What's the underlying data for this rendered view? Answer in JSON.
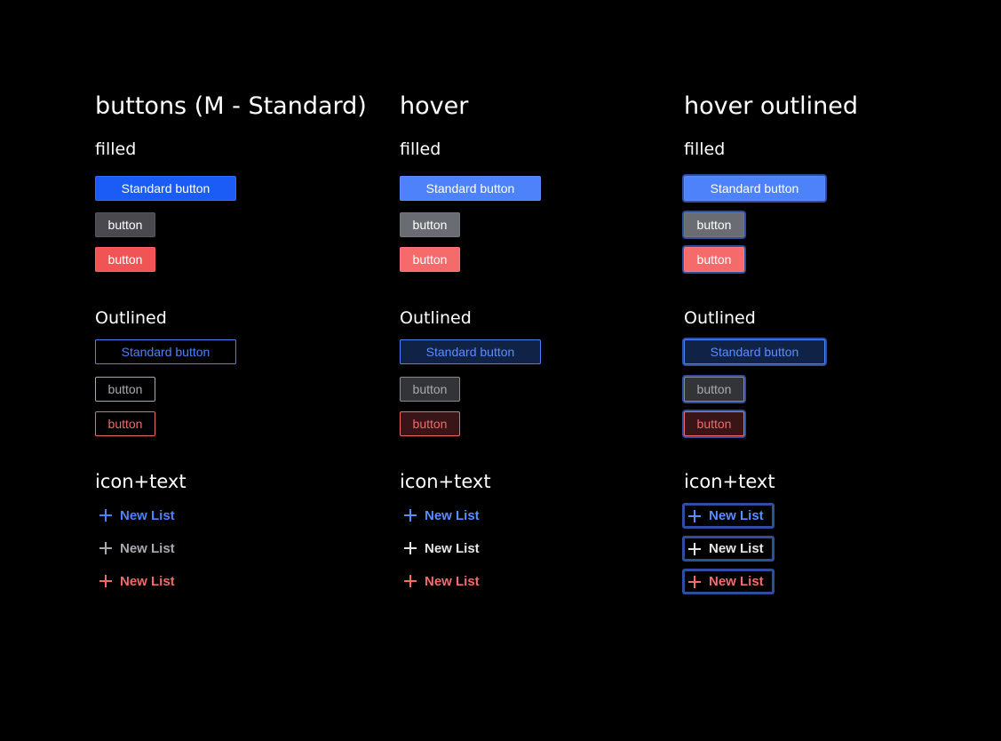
{
  "columns": [
    {
      "title": "buttons (M - Standard)",
      "filled_label": "filled",
      "outlined_label": "Outlined",
      "icon_text_label": "icon+text",
      "filled": [
        "Standard button",
        "button",
        "button"
      ],
      "outlined": [
        "Standard button",
        "button",
        "button"
      ],
      "icon_text": [
        "New List",
        "New List",
        "New List"
      ]
    },
    {
      "title": "hover",
      "filled_label": "filled",
      "outlined_label": "Outlined",
      "icon_text_label": "icon+text",
      "filled": [
        "Standard button",
        "button",
        "button"
      ],
      "outlined": [
        "Standard button",
        "button",
        "button"
      ],
      "icon_text": [
        "New List",
        "New List",
        "New List"
      ]
    },
    {
      "title": "hover outlined",
      "filled_label": "filled",
      "outlined_label": "Outlined",
      "icon_text_label": "icon+text",
      "filled": [
        "Standard button",
        "button",
        "button"
      ],
      "outlined": [
        "Standard button",
        "button",
        "button"
      ],
      "icon_text": [
        "New List",
        "New List",
        "New List"
      ]
    }
  ],
  "icons": {
    "add": "plus-icon"
  },
  "colors": {
    "background": "#000000",
    "primary": "#1a5cf5",
    "primary_hover": "#4d82fb",
    "neutral": "#4a4a4e",
    "neutral_hover": "#6a6c73",
    "danger": "#f05454",
    "danger_hover": "#f56b6b",
    "focus_ring": "#2e4f9e"
  }
}
